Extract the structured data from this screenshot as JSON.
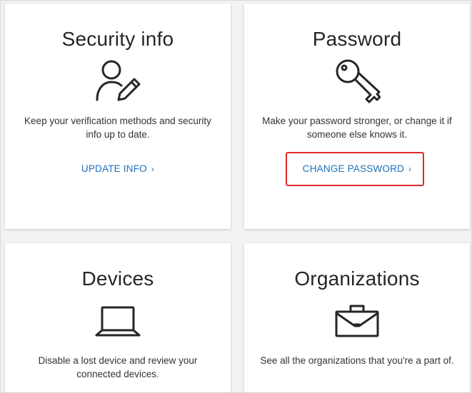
{
  "cards": {
    "security": {
      "title": "Security info",
      "icon": "person-edit-icon",
      "description": "Keep your verification methods and security info up to date.",
      "link_label": "UPDATE INFO"
    },
    "password": {
      "title": "Password",
      "icon": "key-icon",
      "description": "Make your password stronger, or change it if someone else knows it.",
      "link_label": "CHANGE PASSWORD"
    },
    "devices": {
      "title": "Devices",
      "icon": "laptop-icon",
      "description": "Disable a lost device and review your connected devices."
    },
    "organizations": {
      "title": "Organizations",
      "icon": "briefcase-icon",
      "description": "See all the organizations that you're a part of."
    }
  },
  "colors": {
    "link": "#1e6fbf",
    "highlight": "#e0292b",
    "text": "#262626"
  }
}
